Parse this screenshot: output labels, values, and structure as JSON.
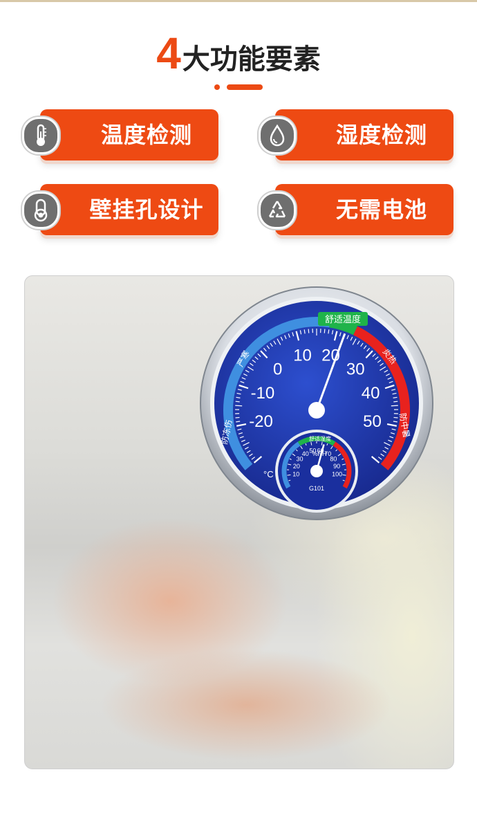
{
  "header": {
    "number": "4",
    "title": "大功能要素"
  },
  "features": [
    {
      "label": "温度检测",
      "icon": "thermometer-icon"
    },
    {
      "label": "湿度检测",
      "icon": "water-drop-icon"
    },
    {
      "label": "壁挂孔设计",
      "icon": "wall-hook-icon"
    },
    {
      "label": "无需电池",
      "icon": "recycle-icon"
    }
  ],
  "gauge": {
    "temperature_ticks": [
      "-20",
      "-10",
      "0",
      "10",
      "20",
      "30",
      "40",
      "50"
    ],
    "unit": "°C",
    "zone_cold": "严寒",
    "zone_frost": "防冻伤",
    "zone_comfort": "舒适温度",
    "zone_hot": "炎热",
    "zone_heatstroke": "防中暑",
    "humidity_ticks": [
      "10",
      "20",
      "30",
      "40",
      "50",
      "60",
      "70",
      "80",
      "90",
      "100"
    ],
    "humidity_unit": "%RH",
    "humidity_comfort": "舒适湿度",
    "model": "G101",
    "temperature_reading": 22,
    "humidity_reading": 62
  },
  "colors": {
    "accent": "#ee4a13",
    "dial_blue": "#1e3aa8",
    "comfort_green": "#1fb34a",
    "hot_red": "#e8221e",
    "cold_blue": "#3f8fe0"
  }
}
